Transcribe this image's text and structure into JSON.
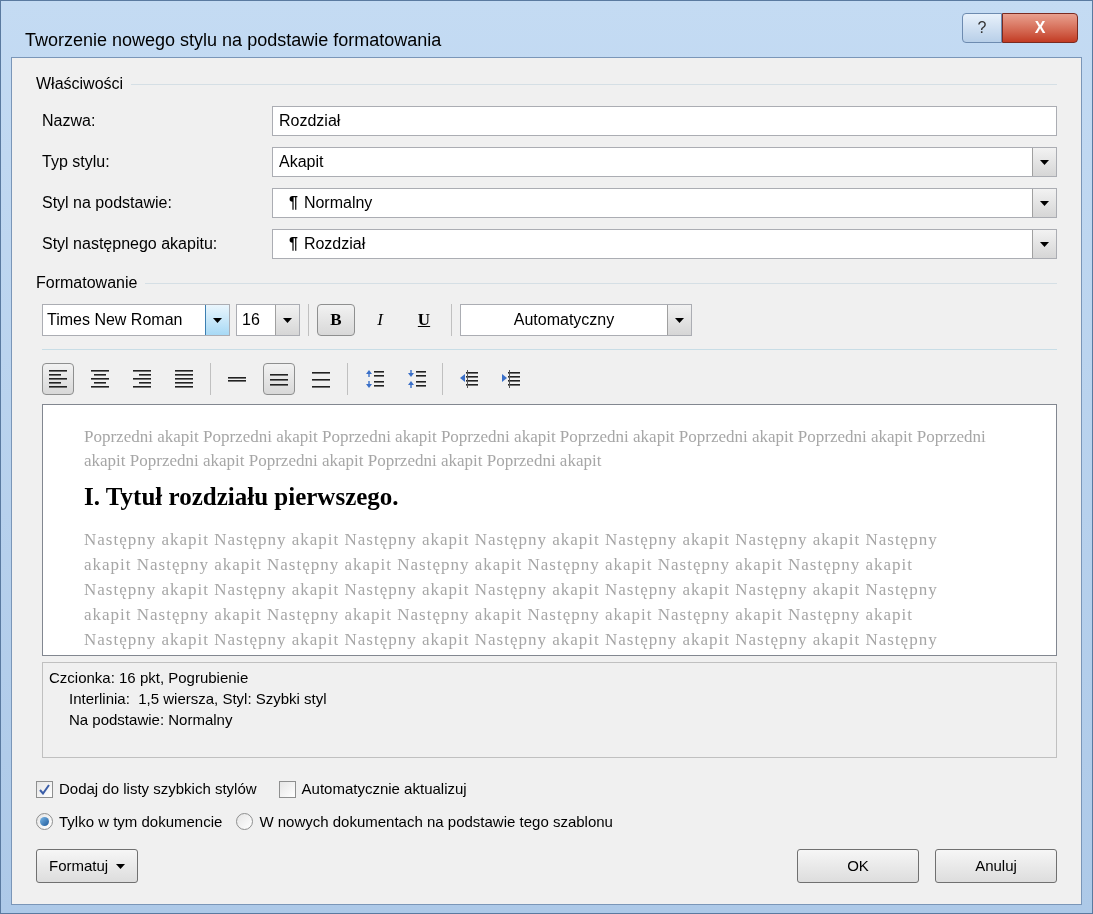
{
  "window": {
    "title": "Tworzenie nowego stylu na podstawie formatowania",
    "help_button": "?",
    "close_button": "X"
  },
  "properties": {
    "heading": "Właściwości",
    "fields": [
      {
        "label": "Nazwa:",
        "value": "Rozdział",
        "kind": "text"
      },
      {
        "label": "Typ stylu:",
        "value": "Akapit",
        "kind": "dropdown"
      },
      {
        "label": "Styl na podstawie:",
        "value": "Normalny",
        "kind": "dropdown",
        "mark": "¶"
      },
      {
        "label": "Styl następnego akapitu:",
        "value": "Rozdział",
        "kind": "dropdown",
        "mark": "¶"
      }
    ]
  },
  "formatting": {
    "heading": "Formatowanie",
    "font": "Times New Roman",
    "size": "16",
    "style_buttons": [
      {
        "label": "B",
        "kind": "bold",
        "selected": true
      },
      {
        "label": "I",
        "kind": "italic",
        "selected": false
      },
      {
        "label": "U",
        "kind": "underline",
        "selected": false
      }
    ],
    "font_color": "Automatyczny",
    "alignment": [
      {
        "kind": "left",
        "selected": true
      },
      {
        "kind": "center",
        "selected": false
      },
      {
        "kind": "right",
        "selected": false
      },
      {
        "kind": "justify",
        "selected": false
      }
    ],
    "line_spacing": [
      {
        "kind": "single",
        "selected": false
      },
      {
        "kind": "one-and-half",
        "selected": true
      },
      {
        "kind": "double",
        "selected": false
      }
    ],
    "paragraph_spacing": [
      {
        "kind": "increase"
      },
      {
        "kind": "decrease"
      }
    ],
    "indent": [
      {
        "kind": "decrease"
      },
      {
        "kind": "increase"
      }
    ]
  },
  "preview": {
    "previous": "Poprzedni akapit Poprzedni akapit Poprzedni akapit Poprzedni akapit Poprzedni akapit Poprzedni akapit Poprzedni akapit Poprzedni akapit Poprzedni akapit Poprzedni akapit Poprzedni akapit Poprzedni akapit",
    "heading": "I. Tytuł rozdziału pierwszego.",
    "next": "Następny akapit Następny akapit Następny akapit Następny akapit Następny akapit Następny akapit Następny akapit Następny akapit Następny akapit Następny akapit Następny akapit Następny akapit Następny akapit Następny akapit Następny akapit Następny akapit Następny akapit Następny akapit Następny akapit Następny akapit Następny akapit Następny akapit Następny akapit Następny akapit Następny akapit Następny akapit Następny akapit Następny akapit Następny akapit Następny akapit Następny akapit Następny akapit Następny"
  },
  "description": [
    {
      "text": "Czcionka: 16 pkt, Pogrubienie",
      "kind": "main"
    },
    {
      "text": "Interlinia:  1,5 wiersza, Styl: Szybki styl",
      "kind": "detail"
    },
    {
      "text": "Na podstawie: Normalny",
      "kind": "detail"
    }
  ],
  "checkboxes": [
    {
      "label": "Dodaj do listy szybkich stylów",
      "checked": true
    },
    {
      "label": "Automatycznie aktualizuj",
      "checked": false
    }
  ],
  "radios": [
    {
      "label": "Tylko w tym dokumencie",
      "selected": true
    },
    {
      "label": "W nowych dokumentach na podstawie tego szablonu",
      "selected": false
    }
  ],
  "buttons": {
    "format": "Formatuj",
    "ok": "OK",
    "cancel": "Anuluj"
  }
}
